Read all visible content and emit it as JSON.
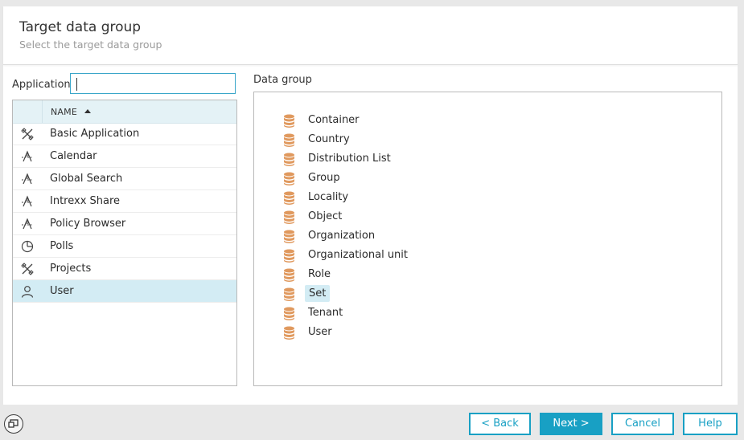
{
  "header": {
    "title": "Target data group",
    "subtitle": "Select the target data group"
  },
  "application": {
    "label": "Application",
    "search_value": "",
    "column_name": "NAME",
    "sort": "ascending",
    "items": [
      {
        "label": "Basic Application",
        "icon": "tools-icon",
        "selected": false
      },
      {
        "label": "Calendar",
        "icon": "app-icon",
        "selected": false
      },
      {
        "label": "Global Search",
        "icon": "app-icon",
        "selected": false
      },
      {
        "label": "Intrexx Share",
        "icon": "app-icon",
        "selected": false
      },
      {
        "label": "Policy Browser",
        "icon": "app-icon",
        "selected": false
      },
      {
        "label": "Polls",
        "icon": "pie-chart-icon",
        "selected": false
      },
      {
        "label": "Projects",
        "icon": "tools-icon",
        "selected": false
      },
      {
        "label": "User",
        "icon": "user-icon",
        "selected": true
      }
    ]
  },
  "data_group": {
    "label": "Data group",
    "icon": "database-icon",
    "icon_color": "#e0995e",
    "items": [
      {
        "label": "Container",
        "selected": false
      },
      {
        "label": "Country",
        "selected": false
      },
      {
        "label": "Distribution List",
        "selected": false
      },
      {
        "label": "Group",
        "selected": false
      },
      {
        "label": "Locality",
        "selected": false
      },
      {
        "label": "Object",
        "selected": false
      },
      {
        "label": "Organization",
        "selected": false
      },
      {
        "label": "Organizational unit",
        "selected": false
      },
      {
        "label": "Role",
        "selected": false
      },
      {
        "label": "Set",
        "selected": true
      },
      {
        "label": "Tenant",
        "selected": false
      },
      {
        "label": "User",
        "selected": false
      }
    ]
  },
  "footer": {
    "back_label": "< Back",
    "next_label": "Next >",
    "cancel_label": "Cancel",
    "help_label": "Help",
    "accent_color": "#18a0c4"
  }
}
